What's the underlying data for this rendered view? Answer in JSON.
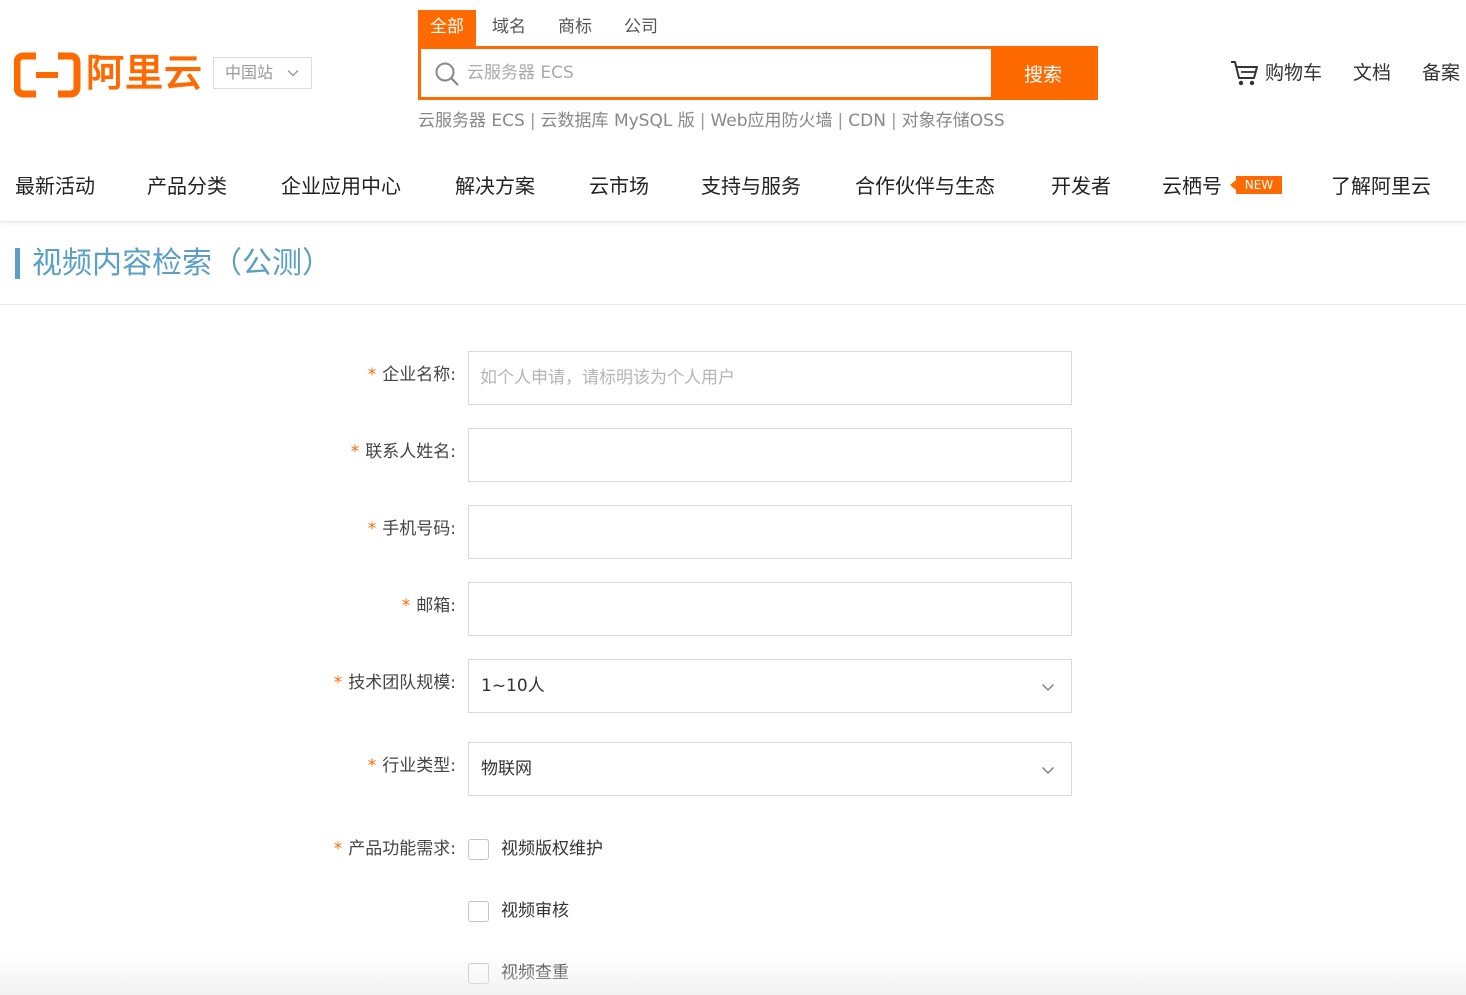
{
  "header": {
    "logo_text": "阿里云",
    "region": "中国站",
    "search_tabs": [
      "全部",
      "域名",
      "商标",
      "公司"
    ],
    "search_placeholder": "云服务器 ECS",
    "search_button": "搜索",
    "hot_links": [
      "云服务器 ECS",
      "云数据库 MySQL 版",
      "Web应用防火墙",
      "CDN",
      "对象存储OSS"
    ],
    "cart": "购物车",
    "docs": "文档",
    "beian": "备案"
  },
  "nav": {
    "items": [
      "最新活动",
      "产品分类",
      "企业应用中心",
      "解决方案",
      "云市场",
      "支持与服务",
      "合作伙伴与生态",
      "开发者",
      "云栖号",
      "了解阿里云"
    ],
    "new_badge": "NEW"
  },
  "page": {
    "title": "视频内容检索（公测）"
  },
  "form": {
    "required_mark": "*",
    "company_label": "企业名称:",
    "company_placeholder": "如个人申请，请标明该为个人用户",
    "contact_label": "联系人姓名:",
    "phone_label": "手机号码:",
    "email_label": "邮箱:",
    "team_label": "技术团队规模:",
    "team_value": "1~10人",
    "industry_label": "行业类型:",
    "industry_value": "物联网",
    "needs_label": "产品功能需求:",
    "needs_options": [
      "视频版权维护",
      "视频审核",
      "视频查重"
    ]
  },
  "colors": {
    "brand": "#ff6a00",
    "title_blue": "#5a9fc6"
  }
}
